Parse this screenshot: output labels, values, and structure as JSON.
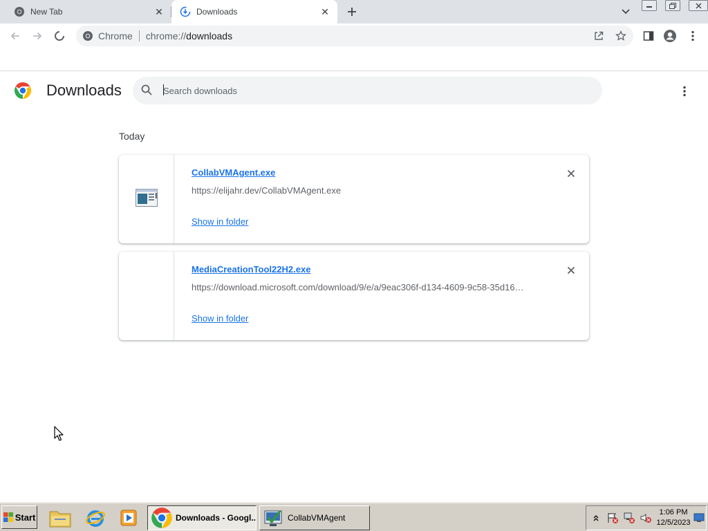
{
  "browser": {
    "tabs": [
      {
        "title": "New Tab",
        "active": false
      },
      {
        "title": "Downloads",
        "active": true
      }
    ],
    "omnibox": {
      "site_label": "Chrome",
      "scheme": "chrome://",
      "host": "downloads"
    }
  },
  "downloads_page": {
    "title": "Downloads",
    "search": {
      "placeholder": "Search downloads",
      "value": ""
    },
    "date_heading": "Today",
    "items": [
      {
        "file_name": "CollabVMAgent.exe",
        "url": "https://elijahr.dev/CollabVMAgent.exe",
        "action_label": "Show in folder",
        "icon": "exe-file-icon"
      },
      {
        "file_name": "MediaCreationTool22H2.exe",
        "url": "https://download.microsoft.com/download/9/e/a/9eac306f-d134-4609-9c58-35d16…",
        "action_label": "Show in folder",
        "icon": "none"
      }
    ]
  },
  "taskbar": {
    "start_label": "Start",
    "tasks": [
      {
        "label": "Downloads - Googl...",
        "active": true,
        "icon": "chrome-icon"
      },
      {
        "label": "CollabVMAgent",
        "active": false,
        "icon": "collabvm-agent-icon"
      }
    ],
    "clock": {
      "time": "1:06 PM",
      "date": "12/5/2023"
    }
  },
  "colors": {
    "link_blue": "#1a73e8",
    "tabstrip_bg": "#dee1e6",
    "omnibox_bg": "#f1f3f4",
    "taskbar_bg": "#d4d0c8"
  }
}
